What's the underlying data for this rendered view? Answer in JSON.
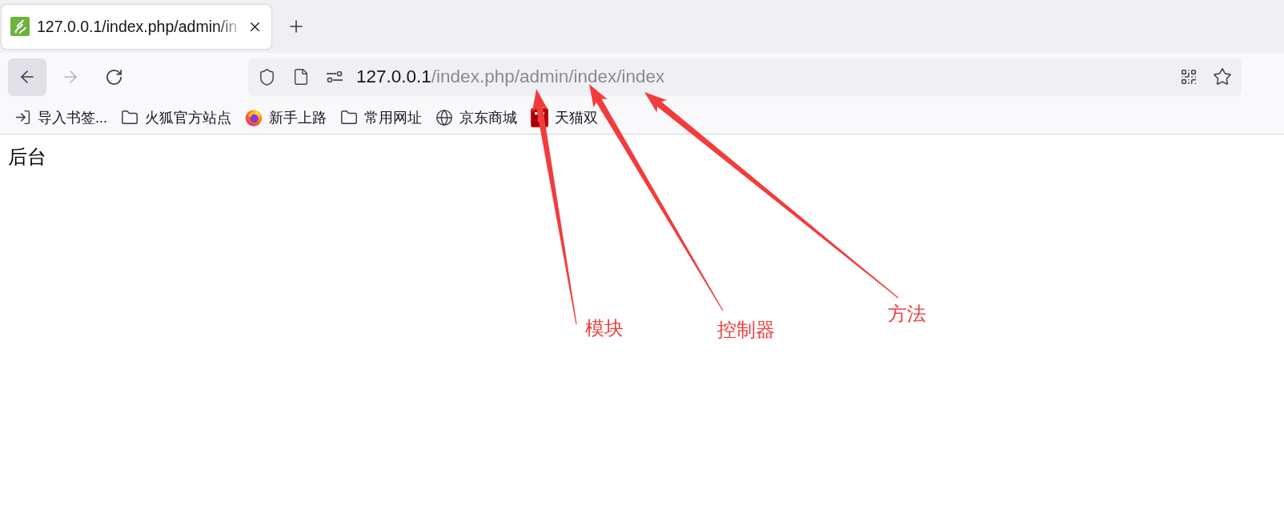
{
  "tabs": [
    {
      "title": "127.0.0.1/index.php/admin/in",
      "selected": true
    }
  ],
  "nav_buttons": [
    {
      "kind": "back",
      "disabled": false,
      "hovered": true
    },
    {
      "kind": "forward",
      "disabled": true,
      "hovered": false
    },
    {
      "kind": "reload",
      "disabled": false,
      "hovered": false
    }
  ],
  "address_bar": {
    "host": "127.0.0.1",
    "path": "/index.php/admin/index/index"
  },
  "bookmarks": [
    {
      "kind": "import",
      "label": "导入书签..."
    },
    {
      "kind": "folder",
      "label": "火狐官方站点"
    },
    {
      "kind": "fox",
      "label": "新手上路"
    },
    {
      "kind": "folder",
      "label": "常用网址"
    },
    {
      "kind": "globe",
      "label": "京东商城"
    },
    {
      "kind": "tmall",
      "label": "天猫双"
    }
  ],
  "page": {
    "text": "后台"
  },
  "annotations": [
    {
      "label": "模块"
    },
    {
      "label": "控制器"
    },
    {
      "label": "方法"
    }
  ]
}
